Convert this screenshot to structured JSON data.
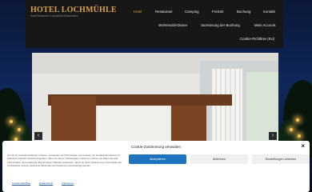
{
  "site": {
    "logo": "HOTEL LOCHMÜHLE",
    "tagline": "Hotel Restaurant Lochmühle Weikersheim"
  },
  "nav": {
    "row1": [
      "Hotel",
      "Restaurant",
      "Camping",
      "Freizeit",
      "Buchung",
      "Kontakt"
    ],
    "row2": [
      "Wohnmobil-Dinner",
      "Stornierung der Buchung",
      "Mein Account"
    ],
    "row3": [
      "Cookie-Richtlinie (EU)"
    ],
    "active": "Hotel",
    "accent_color": "#d7a24a"
  },
  "slider": {
    "prev_icon": "chevron-left-icon",
    "next_icon": "chevron-right-icon",
    "prev_glyph": "‹",
    "next_glyph": "›"
  },
  "cookie": {
    "title": "Cookie-Zustimmung verwalten",
    "close_glyph": "×",
    "text": "Um dir ein optimales Erlebnis zu bieten, verwenden wir Technologien wie Cookies, um Geräteinformationen zu speichern und/oder darauf zuzugreifen. Wenn du diesen Technologien zustimmst, können wir Daten wie das Surfverhalten oder eindeutige IDs auf dieser Website verarbeiten. Wenn du deine Zustimmung nicht erteilst oder zurückziehst, können bestimmte Merkmale und Funktionen beeinträchtigt werden.",
    "accept_label": "Akzeptieren",
    "deny_label": "Ablehnen",
    "settings_label": "Einstellungen ansehen",
    "links": [
      "Cookie-Richtlinie",
      "Datenschutz",
      "Impressum"
    ],
    "accept_color": "#1e73be"
  }
}
